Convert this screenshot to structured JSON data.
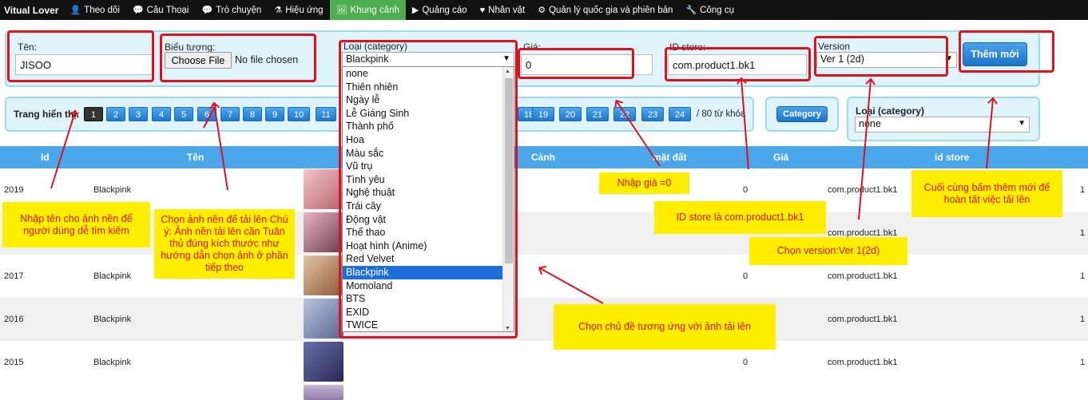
{
  "nav": {
    "brand": "Vitual Lover",
    "items": [
      {
        "label": "Theo dõi",
        "icon": "user-icon",
        "glyph": "👤"
      },
      {
        "label": "Câu Thoại",
        "icon": "chat-icon",
        "glyph": "💬"
      },
      {
        "label": "Trò chuyện",
        "icon": "chat-bubbles-icon",
        "glyph": "💬"
      },
      {
        "label": "Hiệu ứng",
        "icon": "magic-icon",
        "glyph": "⚗"
      },
      {
        "label": "Khung cảnh",
        "icon": "picture-icon",
        "glyph": "🖼",
        "active": true
      },
      {
        "label": "Quảng cáo",
        "icon": "play-circle-icon",
        "glyph": "▶"
      },
      {
        "label": "Nhân vật",
        "icon": "heart-icon",
        "glyph": "♥"
      },
      {
        "label": "Quản lý quốc gia và phiên bản",
        "icon": "gear-icon",
        "glyph": "⚙"
      },
      {
        "label": "Công cụ",
        "icon": "wrench-icon",
        "glyph": "🔧"
      }
    ]
  },
  "form": {
    "name_label": "Tên:",
    "name_value": "JISOO",
    "icon_label": "Biểu tượng:",
    "choose_file": "Choose File",
    "no_file": "No file chosen",
    "category_label": "Loại (category)",
    "category_value": "Blackpink",
    "price_label": "Giá:",
    "price_value": "0",
    "store_label": "ID store:",
    "store_value": "com.product1.bk1",
    "version_label": "Version",
    "version_value": "Ver 1 (2d)",
    "add_button": "Thêm mới"
  },
  "category_options": [
    "none",
    "Thiên nhiên",
    "Ngày lễ",
    "Lễ Giáng Sinh",
    "Thành phố",
    "Hoa",
    "Màu sắc",
    "Vũ trụ",
    "Tình yêu",
    "Nghệ thuật",
    "Trái cây",
    "Động vật",
    "Thể thao",
    "Hoạt hình (Anime)",
    "Red Velvet",
    "Blackpink",
    "Momoland",
    "BTS",
    "EXID",
    "TWICE"
  ],
  "category_selected": "Blackpink",
  "pager": {
    "label": "Trang hiển thị:",
    "pages_left": [
      "1",
      "2",
      "3",
      "4",
      "5",
      "6",
      "7",
      "8",
      "9",
      "10",
      "11"
    ],
    "pages_right": [
      "18",
      "19",
      "20",
      "21",
      "22",
      "23",
      "24"
    ],
    "total": "/ 80 từ khóa",
    "current": "1",
    "category_button": "Category",
    "filter_label": "Loại (category)",
    "filter_value": "none"
  },
  "table": {
    "headers": {
      "id": "Id",
      "name": "Tên",
      "scene": "Cảnh",
      "ground": "mặt đất",
      "price": "Giá",
      "store": "id store"
    },
    "rows": [
      {
        "id": "2019",
        "name": "Blackpink",
        "price": "0",
        "store": "com.product1.bk1",
        "version": "1"
      },
      {
        "id": "2018",
        "name": "",
        "price": "",
        "store": "com.product1.bk1",
        "version": "1"
      },
      {
        "id": "2017",
        "name": "Blackpink",
        "price": "0",
        "store": "com.product1.bk1",
        "version": "1"
      },
      {
        "id": "2016",
        "name": "Blackpink",
        "price": "0",
        "store": "com.product1.bk1",
        "version": "1"
      },
      {
        "id": "2015",
        "name": "Blackpink",
        "price": "0",
        "store": "com.product1.bk1",
        "version": "1"
      }
    ]
  },
  "notes": {
    "n1": "Nhập tên cho ảnh nền để người dùng dễ tìm kiếm",
    "n2": "Chọn ảnh nền để tải lên Chú ý: Ảnh nền tải lên cần Tuân thủ đúng kích thước như hướng dẫn chọn ảnh ở phần tiếp theo",
    "n3": "Nhập giá =0",
    "n4": "ID store là com.product1.bk1",
    "n5": "Chọn version:Ver 1(2d)",
    "n6": "Cuối cùng bấm thêm mới để hoàn tất việc tải lên",
    "n7": "Chọn chủ đề tương ứng với ảnh tải lên"
  },
  "colors": {
    "accent": "#4aa8ea",
    "annotation": "#e0101c",
    "note_bg": "#ffee00",
    "active_nav": "#4cae4c"
  }
}
